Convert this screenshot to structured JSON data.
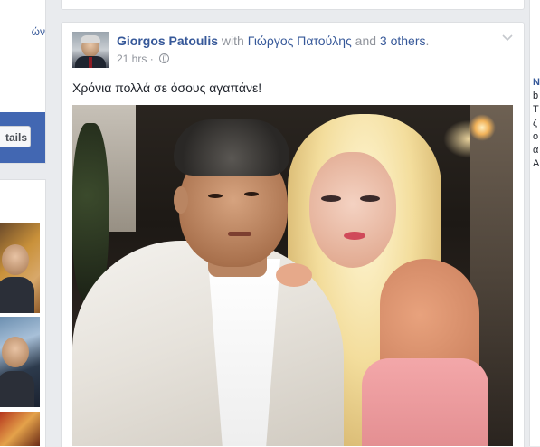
{
  "left_column": {
    "top_card_fragment": "ών",
    "details_button_label": "tails"
  },
  "post": {
    "author": "Giorgos Patoulis",
    "with_word": "with",
    "tagged_person": "Γιώργος Πατούλης",
    "and_word": "and",
    "others_link": "3 others",
    "period": ".",
    "timestamp": "21 hrs",
    "separator": "·",
    "privacy_icon": "globe-icon",
    "menu_icon": "chevron-down-icon",
    "text": "Χρόνια πολλά σε όσους αγαπάνε!"
  },
  "right_sidebar": {
    "fragments": [
      "N",
      "b",
      "T",
      "ζ",
      "ο",
      "α",
      "Α"
    ]
  },
  "colors": {
    "link": "#365899",
    "meta": "#90949c",
    "background": "#e9ebee",
    "brand_blue": "#4267b2"
  }
}
